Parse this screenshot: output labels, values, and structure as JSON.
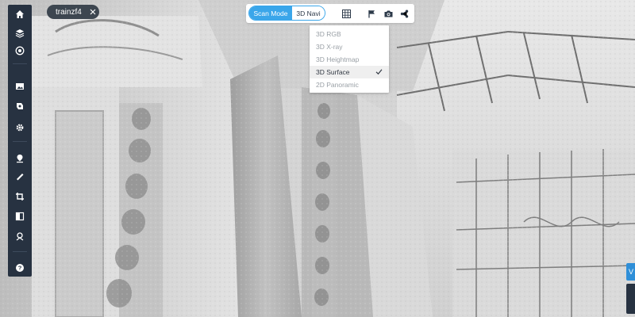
{
  "dataset_chip": {
    "label": "trainzf4",
    "close_icon": "close-icon"
  },
  "topbar": {
    "modes": {
      "active": "Scan Mode",
      "inactive": "3D Navi"
    },
    "icons": [
      "grid-icon",
      "flag-icon",
      "camera-icon",
      "share-icon"
    ]
  },
  "view_menu": {
    "items": [
      {
        "label": "3D RGB"
      },
      {
        "label": "3D X-ray"
      },
      {
        "label": "3D Heightmap"
      },
      {
        "label": "3D Surface"
      },
      {
        "label": "2D Panoramic"
      }
    ],
    "selected": "3D Surface"
  },
  "sidebar": {
    "icons": [
      "home-icon",
      "layers-icon",
      "target-icon",
      "image-icon",
      "gallery-icon",
      "gear-icon",
      "location-icon",
      "ruler-icon",
      "crop-icon",
      "split-view-icon",
      "scan-marker-icon",
      "help-icon"
    ]
  },
  "edge_button": {
    "label": "V"
  },
  "colors": {
    "accent": "#3aa6ea",
    "sidebar": "#273241",
    "chip": "#3d4650"
  }
}
